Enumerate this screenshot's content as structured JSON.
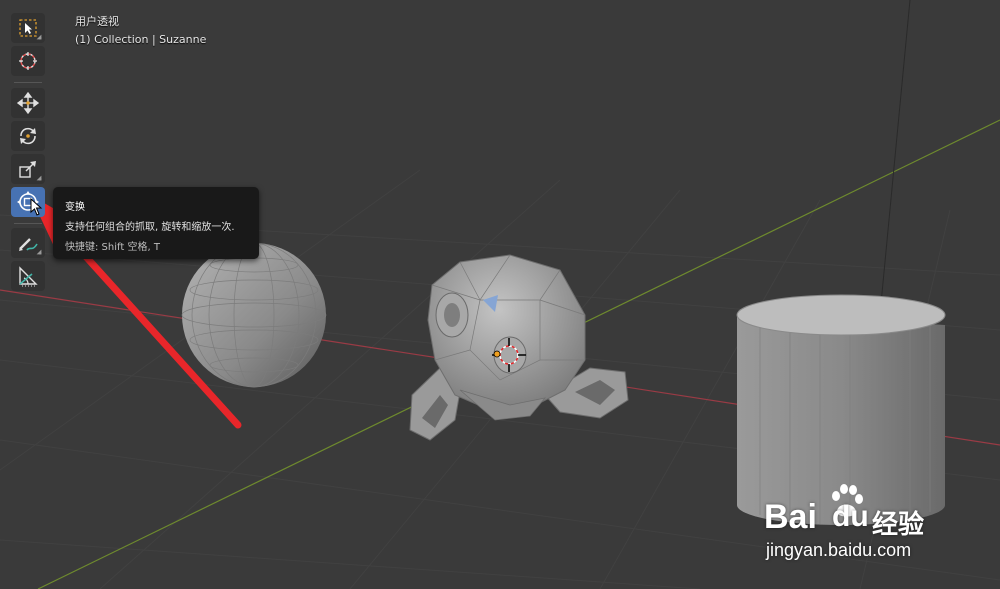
{
  "viewport": {
    "view_name": "用户透视",
    "collection_info": "(1) Collection | Suzanne"
  },
  "toolbar": {
    "tools": [
      {
        "name": "select-box",
        "icon": "select-box-icon",
        "active": false
      },
      {
        "name": "cursor",
        "icon": "cursor-crosshair-icon",
        "active": false
      },
      {
        "name": "move",
        "icon": "move-arrows-icon",
        "active": false
      },
      {
        "name": "rotate",
        "icon": "rotate-icon",
        "active": false
      },
      {
        "name": "scale",
        "icon": "scale-icon",
        "active": false
      },
      {
        "name": "transform",
        "icon": "transform-icon",
        "active": true
      },
      {
        "name": "annotate",
        "icon": "annotate-pencil-icon",
        "active": false
      },
      {
        "name": "measure",
        "icon": "measure-ruler-icon",
        "active": false
      }
    ]
  },
  "tooltip": {
    "title": "变换",
    "description": "支持任何组合的抓取, 旋转和缩放一次.",
    "shortcut": "快捷键: Shift 空格, T"
  },
  "watermark": {
    "brand_left": "Bai",
    "brand_right": "du",
    "brand_cn": "经验",
    "url": "jingyan.baidu.com"
  },
  "colors": {
    "background": "#3a3a3a",
    "active_tool": "#4772b3",
    "tooltip_bg": "#191919",
    "x_axis": "#9a3b45",
    "y_axis": "#6e8a2e",
    "annotation_arrow": "#e8262a"
  }
}
